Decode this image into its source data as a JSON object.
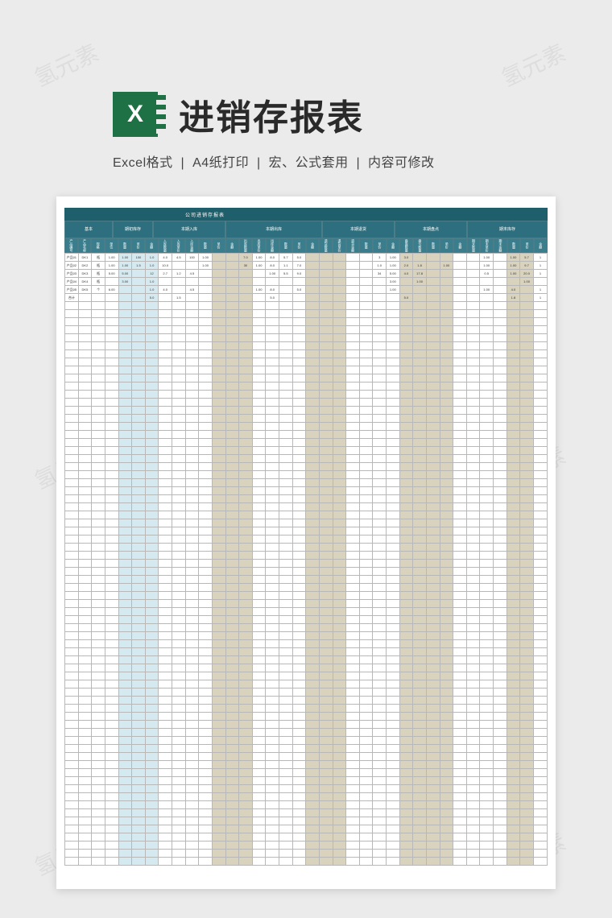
{
  "header": {
    "title": "进销存报表",
    "icon_letter": "X",
    "icon_name": "excel-icon"
  },
  "subtitle_parts": [
    "Excel格式",
    "A4纸打印",
    "宏、公式套用",
    "内容可修改"
  ],
  "watermark": "氢元素",
  "sheet": {
    "inner_title": "公司进销存报表",
    "group_headers": [
      "基本",
      "期初库存",
      "本期入库",
      "本期出库",
      "本期退货",
      "本期盘点",
      "期末库存"
    ],
    "column_headers": [
      "产品编号",
      "产品名称",
      "规格",
      "单位",
      "数量",
      "单价",
      "金额",
      "入库数量",
      "入库单价",
      "入库金额",
      "数量",
      "单价",
      "金额",
      "出库数量",
      "出库单价",
      "出库金额",
      "数量",
      "单价",
      "金额",
      "退货数量",
      "退货单价",
      "退货金额",
      "数量",
      "单价",
      "金额",
      "盘盈数量",
      "盘亏数量",
      "数量",
      "单价",
      "金额",
      "期末数量",
      "期末单价",
      "期末金额",
      "数量",
      "单价",
      "金额"
    ],
    "data_rows": [
      [
        "产品01",
        "DK1",
        "瓶",
        "1.00",
        "1.00",
        "100",
        "1.0",
        "4.0",
        "4.5",
        "100",
        "1.00",
        "",
        "",
        "7.0",
        "1.00",
        "8.0",
        "5.7",
        "5.0",
        "",
        "",
        "",
        "",
        "",
        "3",
        "1.00",
        "3.0",
        "",
        "",
        "",
        "",
        "",
        "1.00",
        "",
        "1.00",
        "5.7",
        "1"
      ],
      [
        "产品02",
        "DK2",
        "瓶",
        "1.00",
        "1.00",
        "1.5",
        "1.0",
        "10.0",
        "",
        "",
        "1.00",
        "",
        "",
        "30",
        "1.00",
        "8.0",
        "1.1",
        "7.0",
        "",
        "",
        "",
        "",
        "",
        "1.0",
        "1.00",
        "2.0",
        "1.8",
        "",
        "1.00",
        "",
        "",
        "1.00",
        "",
        "1.00",
        "9.7",
        "1"
      ],
      [
        "产品03",
        "DK3",
        "瓶",
        "5.00",
        "5.00",
        "",
        "12",
        "2.7",
        "1.2",
        "4.5",
        "",
        "",
        "",
        "",
        "",
        "1.00",
        "5.5",
        "9.0",
        "",
        "",
        "",
        "",
        "",
        "34",
        "5.00",
        "4.0",
        "17.8",
        "",
        "",
        "",
        "",
        "0.5",
        "",
        "1.00",
        "20.0",
        "1"
      ],
      [
        "产品04",
        "DK4",
        "瓶",
        "",
        "3.00",
        "",
        "1.0",
        "",
        "",
        "",
        "",
        "",
        "",
        "",
        "",
        "",
        "",
        "",
        "",
        "",
        "",
        "",
        "",
        "",
        "3.00",
        "",
        "1.00",
        "",
        "",
        "",
        "",
        "",
        "",
        "",
        "1.00",
        ""
      ],
      [
        "产品05",
        "DK5",
        "个",
        "6.00",
        "",
        "",
        "1.0",
        "4.0",
        "",
        "4.5",
        "",
        "",
        "",
        "",
        "1.00",
        "8.0",
        "",
        "5.0",
        "",
        "",
        "",
        "",
        "",
        "",
        "1.00",
        "",
        "",
        "",
        "",
        "",
        "",
        "1.00",
        "",
        "4.0",
        "",
        "1"
      ],
      [
        "合计",
        "",
        "",
        "",
        "",
        "",
        "5.0",
        "",
        "1.5",
        "",
        "",
        "",
        "",
        "",
        "",
        "5.0",
        "",
        "",
        "",
        "",
        "",
        "",
        "",
        "",
        "",
        "5.0",
        "",
        "",
        "",
        "",
        "",
        "",
        "",
        "1.8",
        "",
        "1"
      ]
    ],
    "blank_rows": 70,
    "blue_cols": [
      4,
      5,
      6
    ],
    "tan_cols": [
      11,
      12,
      13,
      18,
      19,
      20,
      25,
      26,
      27,
      28,
      33,
      34
    ]
  },
  "colors": {
    "page_bg": "#ebebeb",
    "excel_green": "#1e7145",
    "header_teal_dark": "#1f5e6b",
    "header_teal": "#2d6f7e",
    "header_teal_light": "#3a7e8d",
    "col_blue": "#d4eaf0",
    "col_tan": "#d9d3bd"
  }
}
